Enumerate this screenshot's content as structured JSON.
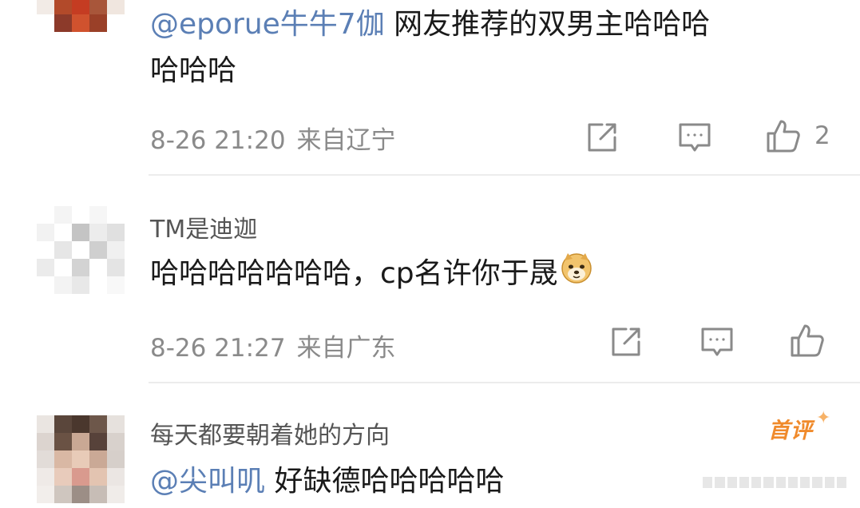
{
  "comments": [
    {
      "mention": "@eporue牛牛7伽",
      "text_line1": " 网友推荐的双男主哈哈哈",
      "text_line2": "哈哈哈",
      "time": "8-26 21:20",
      "location": "来自辽宁",
      "like_count": "2"
    },
    {
      "username": "TM是迪迦",
      "text": "哈哈哈哈哈哈哈，cp名许你于晟",
      "emoji": "doge-emoji",
      "time": "8-26 21:27",
      "location": "来自广东"
    },
    {
      "username": "每天都要朝着她的方向",
      "badge": "首评",
      "mention": "@尖叫叽",
      "text": " 好缺德哈哈哈哈哈"
    }
  ],
  "icons": {
    "share": "share-icon",
    "comment": "comment-icon",
    "like": "thumbs-up-icon"
  },
  "colors": {
    "mention": "#5b7fb5",
    "meta": "#8a8a8a",
    "badge": "#f08a2b",
    "divider": "#ececec"
  }
}
